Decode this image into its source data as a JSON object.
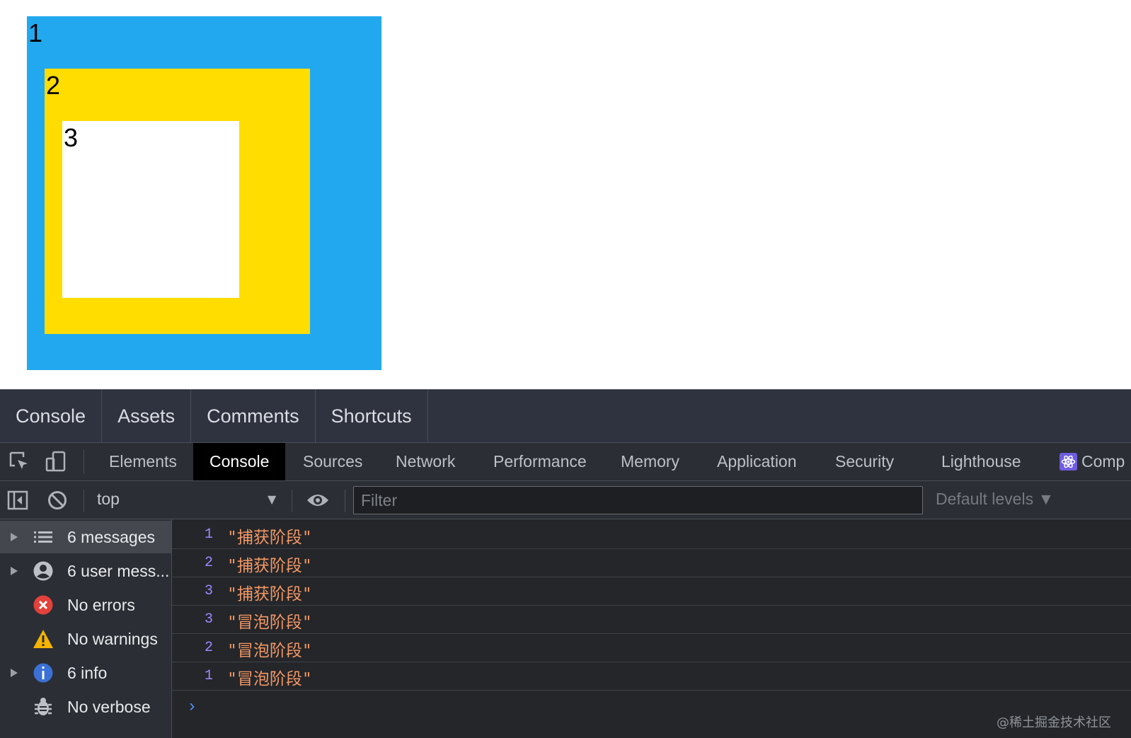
{
  "page": {
    "boxes": [
      {
        "label": "1",
        "color": "#22a8ee"
      },
      {
        "label": "2",
        "color": "#ffdd00"
      },
      {
        "label": "3",
        "color": "#ffffff"
      }
    ]
  },
  "drawer_tabs": [
    "Console",
    "Assets",
    "Comments",
    "Shortcuts"
  ],
  "main_tabs": [
    "Elements",
    "Console",
    "Sources",
    "Network",
    "Performance",
    "Memory",
    "Application",
    "Security",
    "Lighthouse",
    "Comp"
  ],
  "active_main_tab": "Console",
  "toolbar": {
    "context": "top",
    "filter_placeholder": "Filter",
    "levels": "Default levels ▼"
  },
  "sidebar": [
    {
      "label": "6 messages",
      "icon": "list-icon"
    },
    {
      "label": "6 user mess...",
      "icon": "user-icon"
    },
    {
      "label": "No errors",
      "icon": "error-icon"
    },
    {
      "label": "No warnings",
      "icon": "warning-icon"
    },
    {
      "label": "6 info",
      "icon": "info-icon"
    },
    {
      "label": "No verbose",
      "icon": "bug-icon"
    }
  ],
  "log": [
    {
      "n": "1",
      "text": "\"捕获阶段\""
    },
    {
      "n": "2",
      "text": "\"捕获阶段\""
    },
    {
      "n": "3",
      "text": "\"捕获阶段\""
    },
    {
      "n": "3",
      "text": "\"冒泡阶段\""
    },
    {
      "n": "2",
      "text": "\"冒泡阶段\""
    },
    {
      "n": "1",
      "text": "\"冒泡阶段\""
    }
  ],
  "prompt": "›",
  "watermark": "@稀土掘金技术社区"
}
